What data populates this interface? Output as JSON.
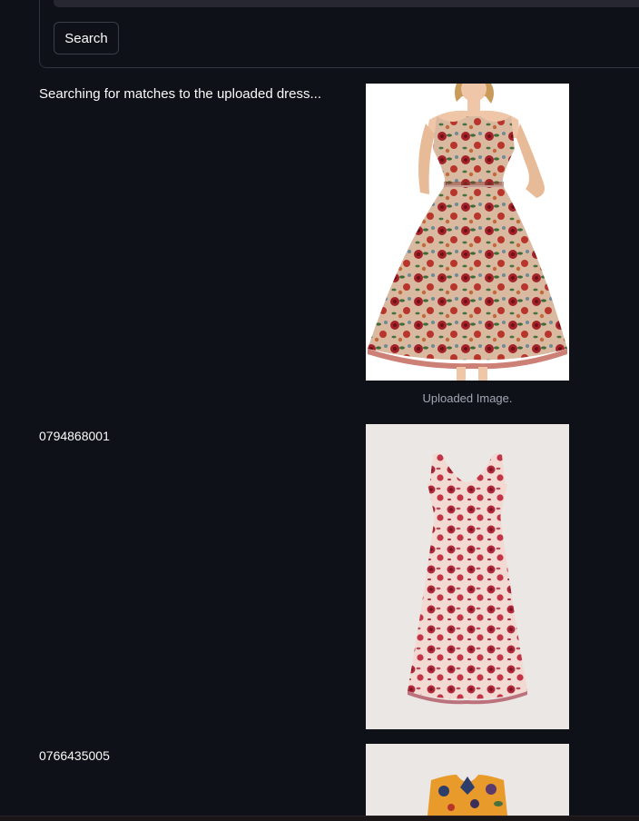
{
  "form": {
    "search_label": "Search"
  },
  "status": {
    "message": "Searching for matches to the uploaded dress..."
  },
  "uploaded": {
    "caption": "Uploaded Image."
  },
  "results": [
    {
      "article_id": "0794868001"
    },
    {
      "article_id": "0766435005"
    }
  ],
  "colors": {
    "background": "#0e1117",
    "border": "#31333f",
    "caption": "#a3a8b4"
  }
}
